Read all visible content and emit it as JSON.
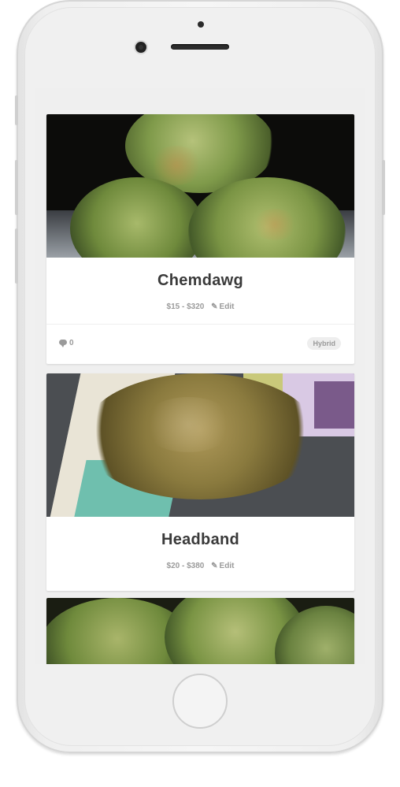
{
  "strains": [
    {
      "name": "Chemdawg",
      "price": "$15 - $320",
      "edit_label": "Edit",
      "comment_count": "0",
      "type": "Hybrid"
    },
    {
      "name": "Headband",
      "price": "$20 - $380",
      "edit_label": "Edit"
    }
  ],
  "colors": {
    "screen_bg": "#efefef",
    "card_bg": "#ffffff",
    "title": "#3a3a3a",
    "muted": "#9a9a9a"
  },
  "icons": {
    "edit": "pencil-icon",
    "comments": "comment-icon"
  }
}
